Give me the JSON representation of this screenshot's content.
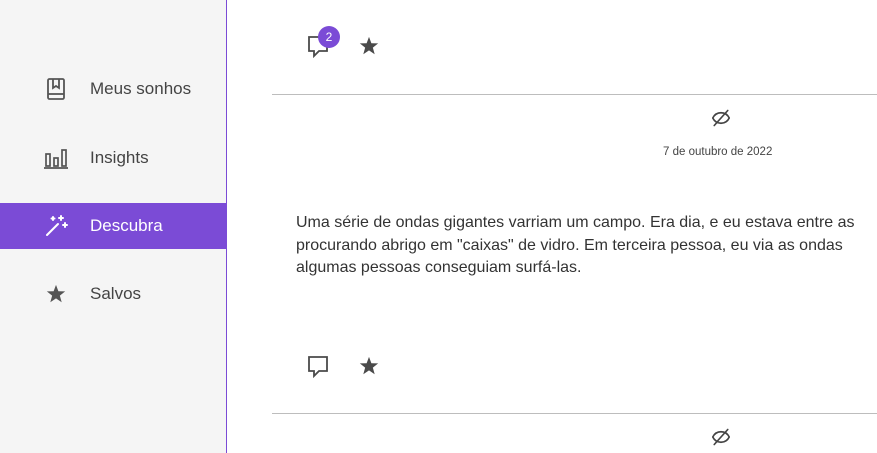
{
  "sidebar": {
    "items": [
      {
        "label": "Meus sonhos",
        "icon": "book-bookmark-icon"
      },
      {
        "label": "Insights",
        "icon": "bar-chart-icon"
      },
      {
        "label": "Descubra",
        "icon": "magic-wand-icon",
        "active": true
      },
      {
        "label": "Salvos",
        "icon": "star-icon"
      }
    ]
  },
  "colors": {
    "accent": "#7b4bd6",
    "sidebar_bg": "#f5f5f5",
    "divider": "#bdbdbd"
  },
  "posts": [
    {
      "comment_count": "2"
    },
    {
      "date": "7 de outubro de 2022",
      "text_lines": [
        "Uma série de ondas gigantes varriam um campo. Era dia, e eu estava entre as",
        "procurando abrigo em \"caixas\" de vidro. Em terceira pessoa, eu via as ondas",
        "algumas pessoas conseguiam surfá-las."
      ]
    }
  ]
}
